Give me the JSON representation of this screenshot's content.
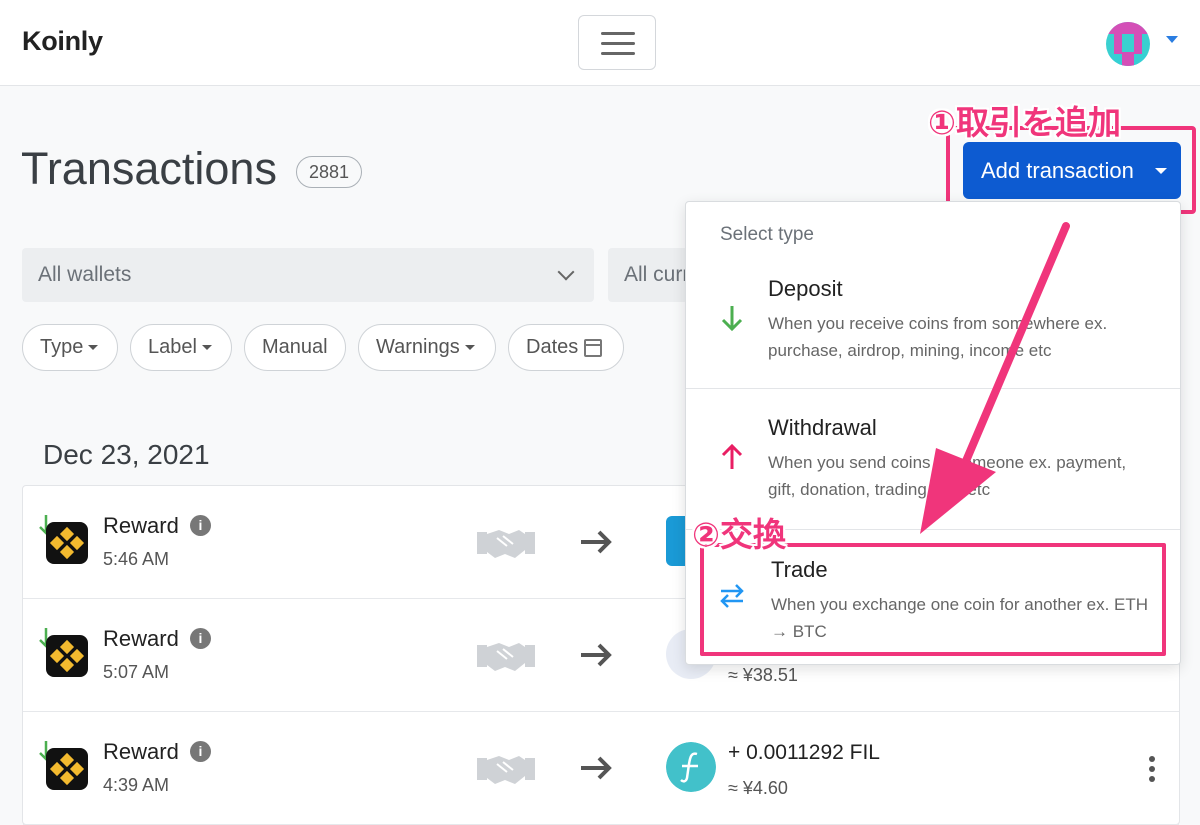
{
  "header": {
    "logo": "Koinly",
    "menu_button": "hamburger-menu"
  },
  "page": {
    "title": "Transactions",
    "count": "2881",
    "add_button": "Add transaction"
  },
  "annotations": {
    "step1": "①取引を追加",
    "step2": "②交換"
  },
  "filters": {
    "wallets": "All wallets",
    "currencies": "All currencies",
    "pills": [
      "Type",
      "Label",
      "Manual",
      "Warnings",
      "Dates"
    ]
  },
  "date_heading": "Dec 23, 2021",
  "transactions": [
    {
      "type": "Reward",
      "time": "5:46 AM",
      "amount": "",
      "value": "",
      "coin_color": "#1a9ad6"
    },
    {
      "type": "Reward",
      "time": "5:07 AM",
      "amount": "",
      "value": "≈ ¥38.51",
      "coin_color": "#e8ecf5"
    },
    {
      "type": "Reward",
      "time": "4:39 AM",
      "amount": "+ 0.0011292 FIL",
      "value": "≈ ¥4.60",
      "coin_color": "#42c1ca"
    }
  ],
  "dropdown": {
    "header": "Select type",
    "items": [
      {
        "title": "Deposit",
        "desc": "When you receive coins from somewhere ex. purchase, airdrop, mining, income etc",
        "icon": "arrow-down-icon",
        "color": "#4caf50"
      },
      {
        "title": "Withdrawal",
        "desc": "When you send coins to someone ex. payment, gift, donation, trading cost etc",
        "icon": "arrow-up-icon",
        "color": "#e91e63"
      },
      {
        "title": "Trade",
        "desc": "When you exchange one coin for another ex. ETH → BTC",
        "icon": "swap-arrows-icon",
        "color": "#2196f3"
      }
    ]
  },
  "colors": {
    "accent": "#0d5bd1",
    "annotation": "#f0357b"
  }
}
